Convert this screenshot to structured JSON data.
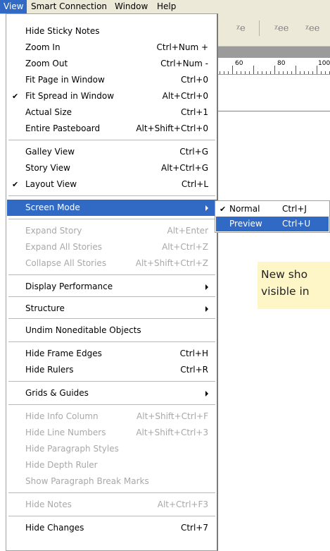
{
  "menubar": {
    "items": [
      "View",
      "Smart Connection",
      "Window",
      "Help"
    ]
  },
  "view_menu": {
    "items": [
      {
        "label": "Hide Sticky Notes",
        "shortcut": "",
        "checked": false,
        "disabled": false,
        "submenu": false
      },
      {
        "label": "Zoom In",
        "shortcut": "Ctrl+Num +",
        "checked": false,
        "disabled": false,
        "submenu": false
      },
      {
        "label": "Zoom Out",
        "shortcut": "Ctrl+Num -",
        "checked": false,
        "disabled": false,
        "submenu": false
      },
      {
        "label": "Fit Page in Window",
        "shortcut": "Ctrl+0",
        "checked": false,
        "disabled": false,
        "submenu": false
      },
      {
        "label": "Fit Spread in Window",
        "shortcut": "Alt+Ctrl+0",
        "checked": true,
        "disabled": false,
        "submenu": false
      },
      {
        "label": "Actual Size",
        "shortcut": "Ctrl+1",
        "checked": false,
        "disabled": false,
        "submenu": false
      },
      {
        "label": "Entire Pasteboard",
        "shortcut": "Alt+Shift+Ctrl+0",
        "checked": false,
        "disabled": false,
        "submenu": false
      },
      {
        "label": "Galley View",
        "shortcut": "Ctrl+G",
        "checked": false,
        "disabled": false,
        "submenu": false
      },
      {
        "label": "Story View",
        "shortcut": "Alt+Ctrl+G",
        "checked": false,
        "disabled": false,
        "submenu": false
      },
      {
        "label": "Layout View",
        "shortcut": "Ctrl+L",
        "checked": true,
        "disabled": false,
        "submenu": false
      },
      {
        "label": "Screen Mode",
        "shortcut": "",
        "checked": false,
        "disabled": false,
        "submenu": true,
        "highlighted": true
      },
      {
        "label": "Expand Story",
        "shortcut": "Alt+Enter",
        "checked": false,
        "disabled": true,
        "submenu": false
      },
      {
        "label": "Expand All Stories",
        "shortcut": "Alt+Ctrl+Z",
        "checked": false,
        "disabled": true,
        "submenu": false
      },
      {
        "label": "Collapse All Stories",
        "shortcut": "Alt+Shift+Ctrl+Z",
        "checked": false,
        "disabled": true,
        "submenu": false
      },
      {
        "label": "Display Performance",
        "shortcut": "",
        "checked": false,
        "disabled": false,
        "submenu": true
      },
      {
        "label": "Structure",
        "shortcut": "",
        "checked": false,
        "disabled": false,
        "submenu": true
      },
      {
        "label": "Undim Noneditable Objects",
        "shortcut": "",
        "checked": false,
        "disabled": false,
        "submenu": false
      },
      {
        "label": "Hide Frame Edges",
        "shortcut": "Ctrl+H",
        "checked": false,
        "disabled": false,
        "submenu": false
      },
      {
        "label": "Hide Rulers",
        "shortcut": "Ctrl+R",
        "checked": false,
        "disabled": false,
        "submenu": false
      },
      {
        "label": "Grids & Guides",
        "shortcut": "",
        "checked": false,
        "disabled": false,
        "submenu": true
      },
      {
        "label": "Hide Info Column",
        "shortcut": "Alt+Shift+Ctrl+F",
        "checked": false,
        "disabled": true,
        "submenu": false
      },
      {
        "label": "Hide Line Numbers",
        "shortcut": "Alt+Shift+Ctrl+3",
        "checked": false,
        "disabled": true,
        "submenu": false
      },
      {
        "label": "Hide Paragraph Styles",
        "shortcut": "",
        "checked": false,
        "disabled": true,
        "submenu": false
      },
      {
        "label": "Hide Depth Ruler",
        "shortcut": "",
        "checked": false,
        "disabled": true,
        "submenu": false
      },
      {
        "label": "Show Paragraph Break Marks",
        "shortcut": "",
        "checked": false,
        "disabled": true,
        "submenu": false
      },
      {
        "label": "Hide Notes",
        "shortcut": "Alt+Ctrl+F3",
        "checked": false,
        "disabled": true,
        "submenu": false
      },
      {
        "label": "Hide Changes",
        "shortcut": "Ctrl+7",
        "checked": false,
        "disabled": false,
        "submenu": false
      }
    ]
  },
  "screen_mode_submenu": {
    "items": [
      {
        "label": "Normal",
        "shortcut": "Ctrl+J",
        "checked": true,
        "highlighted": false
      },
      {
        "label": "Preview",
        "shortcut": "Ctrl+U",
        "checked": false,
        "highlighted": true
      }
    ]
  },
  "ruler": {
    "labels": [
      "60",
      "80",
      "100"
    ]
  },
  "note": {
    "line1": "New sho",
    "line2": "visible in"
  },
  "colors": {
    "highlight": "#316ac5",
    "disabled_text": "#a8a8a8",
    "note_background": "#fff6c8",
    "guide": "#e040e0"
  },
  "icons": {
    "check": "check-icon",
    "submenu_arrow": "submenu-arrow-icon"
  }
}
